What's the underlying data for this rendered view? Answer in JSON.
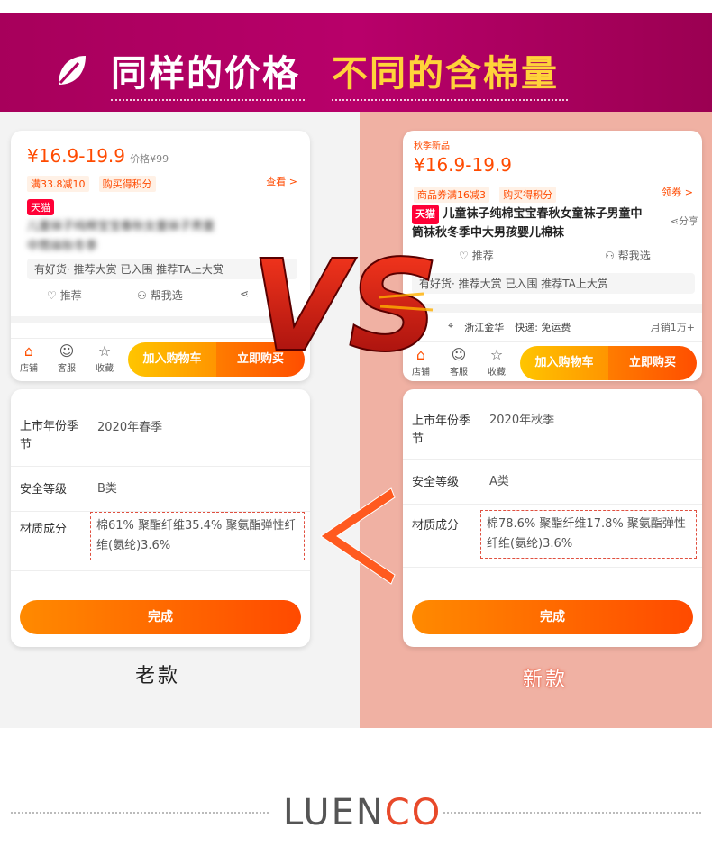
{
  "banner": {
    "title_left": "同样的价格",
    "title_right": "不同的含棉量",
    "accent_color": "#b0005f"
  },
  "old": {
    "price": "¥16.9-19.9",
    "original_price": "价格¥99",
    "coupon1": "满33.8减10",
    "coupon2": "购买得积分",
    "view_link": "查看 >",
    "tmall_badge": "天猫",
    "blurred_title": "儿童袜子纯棉宝宝春秋女童袜子男童中筒袜秋冬季",
    "recommend_text": "有好货· 推荐大赏 已入围 推荐TA上大赏",
    "action_recommend": "推荐",
    "action_help": "帮我选",
    "tab_shop": "店铺",
    "tab_service": "客服",
    "tab_fav": "收藏",
    "btn_cart": "加入购物车",
    "btn_buy": "立即购买",
    "spec_year_label": "上市年份季节",
    "spec_year_value": "2020年春季",
    "spec_safety_label": "安全等级",
    "spec_safety_value": "B类",
    "spec_material_label": "材质成分",
    "spec_material_value": "棉61% 聚酯纤维35.4% 聚氨酯弹性纤维(氨纶)3.6%",
    "done": "完成",
    "caption": "老款"
  },
  "new": {
    "season_tag": "秋季新品",
    "price": "¥16.9-19.9",
    "coupon1": "商品券满16减3",
    "coupon2": "购买得积分",
    "coupon_link": "领券 >",
    "tmall_badge": "天猫",
    "title": "儿童袜子纯棉宝宝春秋女童袜子男童中筒袜秋冬季中大男孩婴儿棉袜",
    "share": "分享",
    "action_recommend": "推荐",
    "action_help": "帮我选",
    "recommend_text": "有好货· 推荐大赏 已入围 推荐TA上大赏",
    "ship_from": "浙江金华",
    "ship_fee": "快递: 免运费",
    "monthly_sales": "月销1万+",
    "tab_shop": "店铺",
    "tab_service": "客服",
    "tab_fav": "收藏",
    "btn_cart": "加入购物车",
    "btn_buy": "立即购买",
    "spec_year_label": "上市年份季节",
    "spec_year_value": "2020年秋季",
    "spec_safety_label": "安全等级",
    "spec_safety_value": "A类",
    "spec_material_label": "材质成分",
    "spec_material_value": "棉78.6% 聚酯纤维17.8% 聚氨酯弹性纤维(氨纶)3.6%",
    "done": "完成",
    "caption": "新款"
  },
  "vs_text": "VS",
  "compare_symbol": "<",
  "brand": {
    "part1": "LUEN",
    "part2": "CO"
  }
}
